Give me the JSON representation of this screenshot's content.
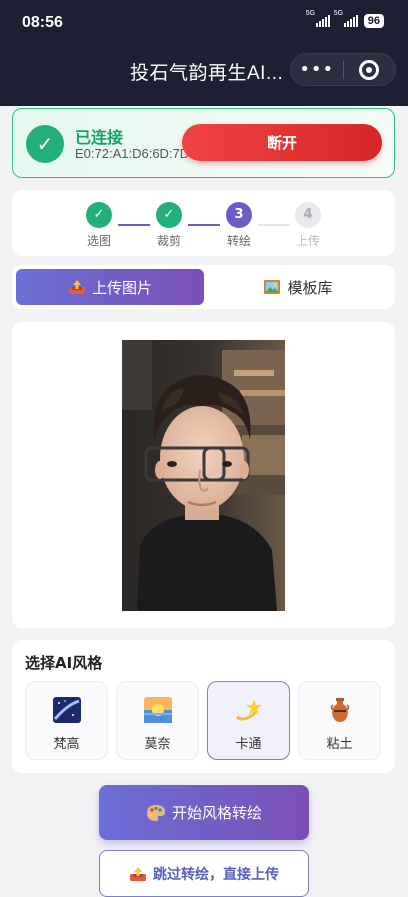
{
  "status_bar": {
    "time": "08:56",
    "network": "5G",
    "battery": "96"
  },
  "nav": {
    "title": "投石气韵再生AI...",
    "more_icon": "•••"
  },
  "connection": {
    "status": "已连接",
    "mac": "E0:72:A1:D6:6D:7D",
    "disconnect_label": "断开",
    "check_icon": "✓"
  },
  "steps": [
    {
      "label": "选图",
      "mark": "✓",
      "state": "done"
    },
    {
      "label": "裁剪",
      "mark": "✓",
      "state": "done"
    },
    {
      "label": "转绘",
      "mark": "3",
      "state": "current"
    },
    {
      "label": "上传",
      "mark": "4",
      "state": "todo"
    }
  ],
  "tabs": [
    {
      "label": "上传图片",
      "icon": "outbox-tray-icon",
      "active": true
    },
    {
      "label": "模板库",
      "icon": "framed-picture-icon",
      "active": false
    }
  ],
  "styles": {
    "title": "选择AI风格",
    "items": [
      {
        "label": "梵高",
        "icon": "milky-way-icon",
        "selected": false
      },
      {
        "label": "莫奈",
        "icon": "sunrise-icon",
        "selected": false
      },
      {
        "label": "卡通",
        "icon": "dizzy-star-icon",
        "selected": true
      },
      {
        "label": "粘土",
        "icon": "amphora-icon",
        "selected": false
      }
    ]
  },
  "actions": {
    "start_label": "开始风格转绘",
    "skip_label": "跳过转绘，直接上传"
  },
  "colors": {
    "accent": "#6b5cc6",
    "success": "#22b07a",
    "danger": "#e53535",
    "header": "#1d1f33"
  }
}
